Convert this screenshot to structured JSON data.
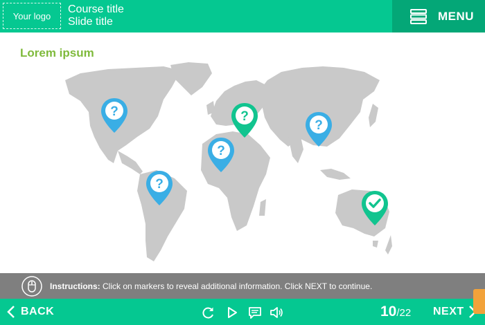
{
  "header": {
    "logo_text": "Your logo",
    "course_title": "Course title",
    "slide_title": "Slide title",
    "menu_label": "MENU"
  },
  "content": {
    "heading": "Lorem ipsum"
  },
  "markers": [
    {
      "name": "north-america",
      "state": "question"
    },
    {
      "name": "south-america",
      "state": "question"
    },
    {
      "name": "europe",
      "state": "question"
    },
    {
      "name": "africa",
      "state": "question"
    },
    {
      "name": "asia",
      "state": "question"
    },
    {
      "name": "australia",
      "state": "completed"
    }
  ],
  "instructions": {
    "label": "Instructions:",
    "text": " Click on markers to reveal additional information. Click NEXT to continue."
  },
  "footer": {
    "back_label": "BACK",
    "next_label": "NEXT",
    "current_slide": "10",
    "total_slides": "/22"
  },
  "colors": {
    "brand": "#05c891",
    "brand_dark": "#04a777",
    "marker_question": "#3aaee5",
    "marker_completed": "#11c48f",
    "heading": "#7fba3c",
    "map_land": "#c9c9c9",
    "instructions_bar": "#7f7f7f"
  },
  "icons": {
    "menu": "hamburger-icon",
    "instructions": "mouse-icon",
    "replay": "replay-icon",
    "play": "play-icon",
    "captions": "captions-icon",
    "audio": "audio-icon"
  }
}
